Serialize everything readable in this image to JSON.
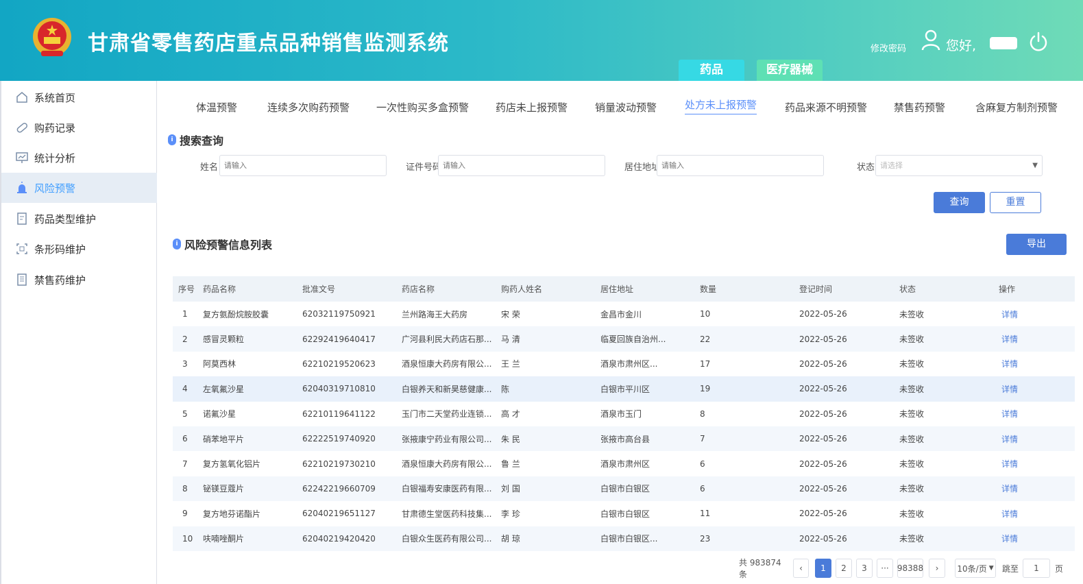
{
  "header": {
    "title": "甘肃省零售药店重点品种销售监测系统",
    "change_password": "修改密码",
    "greeting": "您好,",
    "module_tabs": [
      "药品",
      "医疗器械"
    ]
  },
  "sidebar": {
    "items": [
      {
        "label": "系统首页",
        "icon": "home-icon"
      },
      {
        "label": "购药记录",
        "icon": "pill-icon"
      },
      {
        "label": "统计分析",
        "icon": "chart-board-icon"
      },
      {
        "label": "风险预警",
        "icon": "alarm-icon",
        "active": true
      },
      {
        "label": "药品类型维护",
        "icon": "document-edit-icon"
      },
      {
        "label": "条形码维护",
        "icon": "barcode-scan-icon"
      },
      {
        "label": "禁售药维护",
        "icon": "document-list-icon"
      }
    ]
  },
  "warning_tabs": [
    "体温预警",
    "连续多次购药预警",
    "一次性购买多盒预警",
    "药店未上报预警",
    "销量波动预警",
    "处方未上报预警",
    "药品来源不明预警",
    "禁售药预警",
    "含麻复方制剂预警"
  ],
  "active_warning_tab": "处方未上报预警",
  "search": {
    "title": "搜索查询",
    "name_label": "姓名",
    "name_placeholder": "请输入",
    "id_label": "证件号码",
    "id_placeholder": "请输入",
    "address_label": "居住地址",
    "address_placeholder": "请输入",
    "status_label": "状态",
    "status_placeholder": "请选择",
    "query_button": "查询",
    "reset_button": "重置"
  },
  "list": {
    "title": "风险预警信息列表",
    "export_button": "导出",
    "columns": [
      "序号",
      "药品名称",
      "批准文号",
      "药店名称",
      "购药人姓名",
      "居住地址",
      "数量",
      "登记时间",
      "状态",
      "操作"
    ],
    "rows": [
      [
        "1",
        "复方氨酚烷胺胶囊",
        "62032119750921",
        "兰州路海王大药房",
        "宋  荣",
        "金昌市金川",
        "10",
        "2022-05-26",
        "未签收",
        "详情"
      ],
      [
        "2",
        "感冒灵颗粒",
        "62292419640417",
        "广河县利民大药店石那...",
        "马  清",
        "临夏回族自治州...",
        "22",
        "2022-05-26",
        "未签收",
        "详情"
      ],
      [
        "3",
        "阿莫西林",
        "62210219520623",
        "酒泉恒康大药房有限公...",
        "王  兰",
        "酒泉市肃州区...",
        "17",
        "2022-05-26",
        "未签收",
        "详情"
      ],
      [
        "4",
        "左氧氟沙星",
        "62040319710810",
        "白银养天和新昊慈健康...",
        "陈  ",
        "白银市平川区",
        "19",
        "2022-05-26",
        "未签收",
        "详情"
      ],
      [
        "5",
        "诺氟沙星",
        "62210119641122",
        "玉门市二天堂药业连锁...",
        "高  才",
        "酒泉市玉门",
        "8",
        "2022-05-26",
        "未签收",
        "详情"
      ],
      [
        "6",
        "硝苯地平片",
        "62222519740920",
        "张掖康宁药业有限公司...",
        "朱  民",
        "张掖市高台县",
        "7",
        "2022-05-26",
        "未签收",
        "详情"
      ],
      [
        "7",
        "复方氢氧化铝片",
        "62210219730210",
        "酒泉恒康大药房有限公...",
        "鲁  兰",
        "酒泉市肃州区",
        "6",
        "2022-05-26",
        "未签收",
        "详情"
      ],
      [
        "8",
        "铋镁豆蔻片",
        "62242219660709",
        "白银福寿安康医药有限...",
        "刘  国",
        "白银市白银区",
        "6",
        "2022-05-26",
        "未签收",
        "详情"
      ],
      [
        "9",
        "复方地芬诺酯片",
        "62040219651127",
        "甘肃德生堂医药科技集...",
        "李  珍",
        "白银市白银区",
        "11",
        "2022-05-26",
        "未签收",
        "详情"
      ],
      [
        "10",
        "呋喃唑酮片",
        "62040219420420",
        "白银众生医药有限公司...",
        "胡  琼",
        "白银市白银区...",
        "23",
        "2022-05-26",
        "未签收",
        "详情"
      ]
    ]
  },
  "pagination": {
    "total": "共 983874 条",
    "prev": "‹",
    "pages": [
      "1",
      "2",
      "3"
    ],
    "ellipsis": "···",
    "last": "98388",
    "next": "›",
    "page_size": "10条/页",
    "goto_label": "跳至",
    "goto_value": "1",
    "page_unit": "页"
  },
  "colors": {
    "accent": "#4a7bd9",
    "header_start": "#12a6c4",
    "header_end": "#6fdbb7"
  }
}
